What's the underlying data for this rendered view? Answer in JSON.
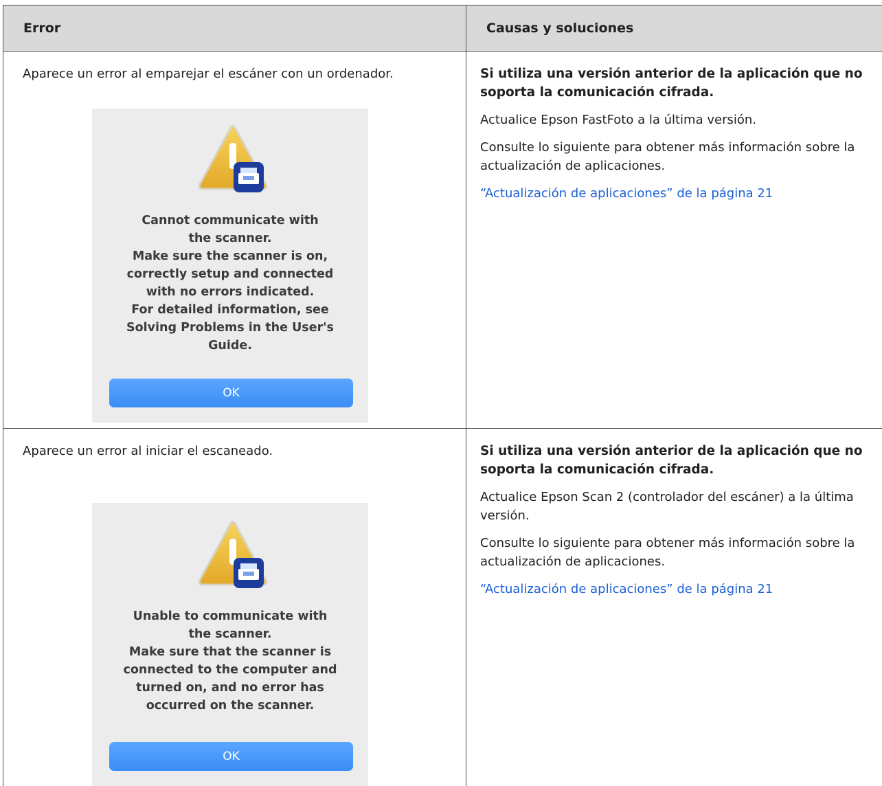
{
  "table": {
    "headers": [
      "Error",
      "Causas y soluciones"
    ],
    "rows": [
      {
        "error": "Aparece un error al emparejar el escáner con un ordenador.",
        "dialog": {
          "lines": [
            "Cannot communicate with",
            "the scanner.",
            "Make sure the scanner is on,",
            "correctly setup and connected",
            "with no errors indicated.",
            "For detailed information, see",
            "Solving Problems in the User's",
            "Guide."
          ],
          "button": "OK"
        },
        "solution_title": "Si utiliza una versión anterior de la aplicación que no soporta la comunicación cifrada.",
        "solution_text": [
          "Actualice Epson FastFoto a la última versión.",
          "Consulte lo siguiente para obtener más información sobre la actualización de aplicaciones."
        ],
        "link": "“Actualización de aplicaciones” de la página 21"
      },
      {
        "error": "Aparece un error al iniciar el escaneado.",
        "dialog": {
          "lines": [
            "Unable to communicate with",
            "the scanner.",
            "Make sure that the scanner is",
            "connected to the computer and",
            "turned on, and no error has",
            "occurred on the scanner."
          ],
          "button": "OK"
        },
        "solution_title": "Si utiliza una versión anterior de la aplicación que no soporta la comunicación cifrada.",
        "solution_text": [
          "Actualice Epson Scan 2 (controlador del escáner) a la última versión.",
          "Consulte lo siguiente para obtener más información sobre la actualización de aplicaciones."
        ],
        "link": "“Actualización de aplicaciones” de la página 21"
      }
    ]
  },
  "colors": {
    "header_bg": "#d9d9d9",
    "link": "#1a5fd6",
    "ok_button": "#3b8df7",
    "warning_yellow": "#f2c23b",
    "scanner_blue": "#1d3c9c"
  },
  "icons": [
    "warning-triangle-icon",
    "scanner-badge-icon"
  ]
}
